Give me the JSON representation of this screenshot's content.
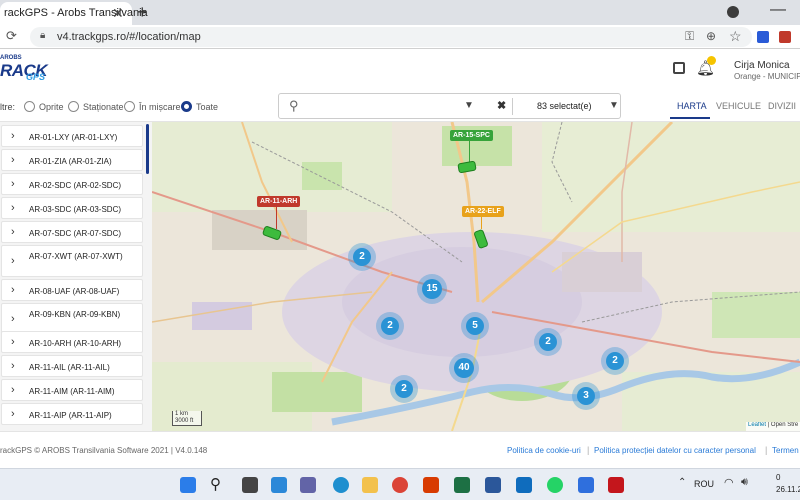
{
  "browser": {
    "tab_title": "rackGPS - Arobs Transilvania",
    "tab_close": "✕",
    "new_tab": "+",
    "url": "v4.trackgps.ro/#/location/map",
    "min_glyph": "—"
  },
  "header": {
    "logo_top": "AROBS",
    "logo_main": "RACK",
    "logo_sub": "GPS",
    "user_name": "Cirja Monica",
    "user_org": "Orange - MUNICIPI..."
  },
  "filters": {
    "label": "ltre:",
    "options": [
      {
        "label": "Oprite",
        "checked": false
      },
      {
        "label": "Staționate",
        "checked": false
      },
      {
        "label": "În mișcare",
        "checked": false
      },
      {
        "label": "Toate",
        "checked": true
      }
    ],
    "selected_count": "83 selectat(e)",
    "clear_glyph": "✖"
  },
  "view_tabs": [
    {
      "label": "HARTA",
      "active": true
    },
    {
      "label": "VEHICULE",
      "active": false
    },
    {
      "label": "DIVIZII",
      "active": false
    }
  ],
  "vehicles": [
    "AR-01-LXY (AR-01-LXY)",
    "AR-01-ZIA (AR-01-ZIA)",
    "AR-02-SDC (AR-02-SDC)",
    "AR-03-SDC (AR-03-SDC)",
    "AR-07-SDC (AR-07-SDC)",
    "AR-07-XWT (AR-07-XWT)",
    "AR-08-UAF (AR-08-UAF)",
    "AR-09-KBN (AR-09-KBN)",
    "AR-10-ARH (AR-10-ARH)",
    "AR-11-AIL (AR-11-AIL)",
    "AR-11-AIM (AR-11-AIM)",
    "AR-11-AIP (AR-11-AIP)"
  ],
  "map": {
    "vehicle_labels": [
      {
        "text": "AR-15-SPC",
        "color": "#36a33a"
      },
      {
        "text": "AR-11-ARH",
        "color": "#c0392b"
      },
      {
        "text": "AR-22-ELF",
        "color": "#e8a21b"
      }
    ],
    "clusters": [
      "2",
      "15",
      "2",
      "5",
      "2",
      "2",
      "40",
      "2",
      "3"
    ],
    "scale_km": "1 km",
    "scale_ft": "3000 ft",
    "attribution_link": "Leaflet",
    "attribution_rest": " | Open Stre"
  },
  "footer": {
    "copyright": "rackGPS © AROBS Transilvania Software 2021",
    "sep": "|",
    "version": "V4.0.148",
    "links": [
      "Politica de cookie-uri",
      "Politica protecției datelor cu caracter personal",
      "Termen"
    ]
  },
  "taskbar": {
    "lang": "ROU",
    "time": "0",
    "date": "26.11.2"
  },
  "colors": {
    "accent": "#1a3a8a",
    "cluster": "#2a93d5",
    "link": "#2a7bd7"
  }
}
